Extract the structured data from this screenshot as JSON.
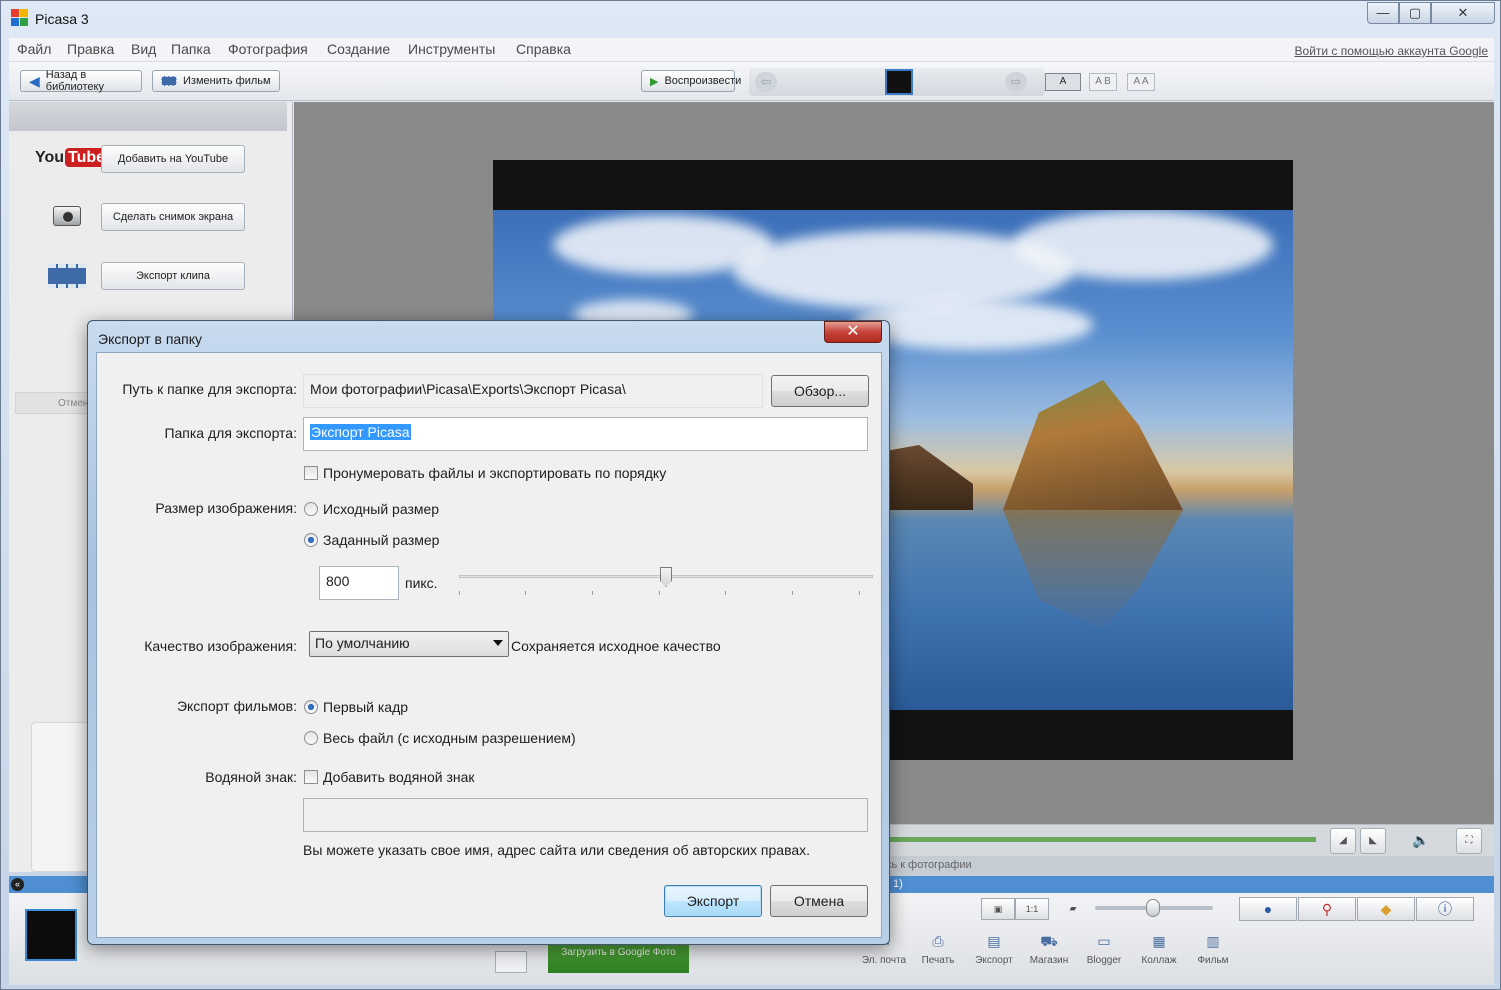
{
  "window": {
    "title": "Picasa 3",
    "minimize": "—",
    "maximize": "▢",
    "close": "✕"
  },
  "menu": {
    "items": [
      "Файл",
      "Правка",
      "Вид",
      "Папка",
      "Фотография",
      "Создание",
      "Инструменты",
      "Справка"
    ],
    "signin": "Войти с помощью аккаунта Google"
  },
  "toolbar": {
    "back": "Назад в библиотеку",
    "edit_movie": "Изменить фильм",
    "play": "Воспроизвести",
    "caption_a": "A",
    "caption_ab": "A B",
    "caption_aa": "A A"
  },
  "left_panel": {
    "youtube_logo_you": "You",
    "youtube_logo_tube": "Tube",
    "upload_youtube": "Добавить на YouTube",
    "screenshot": "Сделать снимок экрана",
    "export_clip": "Экспорт клипа",
    "cancel": "Отмена"
  },
  "timeline": {
    "status_text": "сь к фотографии",
    "bluebar_text": "1)"
  },
  "tray": {
    "upload": "Загрузить в Google Фото",
    "actions": [
      "Эл. почта",
      "Печать",
      "Экспорт",
      "Магазин",
      "Blogger",
      "Коллаж",
      "Фильм"
    ]
  },
  "dialog": {
    "title": "Экспорт в папку",
    "close_glyph": "✕",
    "path_label": "Путь к папке для экспорта:",
    "path_value": "Мои фотографии\\Picasa\\Exports\\Экспорт Picasa\\",
    "browse": "Обзор...",
    "folder_label": "Папка для экспорта:",
    "folder_value": "Экспорт Picasa",
    "number_files": "Пронумеровать файлы и экспортировать по порядку",
    "size_label": "Размер изображения:",
    "size_original": "Исходный размер",
    "size_custom": "Заданный размер",
    "size_value": "800",
    "size_unit": "пикс.",
    "size_slider_fraction": 0.5,
    "quality_label": "Качество изображения:",
    "quality_value": "По умолчанию",
    "quality_note": "Сохраняется исходное качество",
    "movies_label": "Экспорт фильмов:",
    "movies_first": "Первый кадр",
    "movies_full": "Весь файл (с исходным разрешением)",
    "watermark_label": "Водяной знак:",
    "watermark_add": "Добавить водяной знак",
    "watermark_value": "",
    "watermark_hint": "Вы можете указать свое имя, адрес сайта или сведения об авторских правах.",
    "export": "Экспорт",
    "cancel": "Отмена"
  }
}
